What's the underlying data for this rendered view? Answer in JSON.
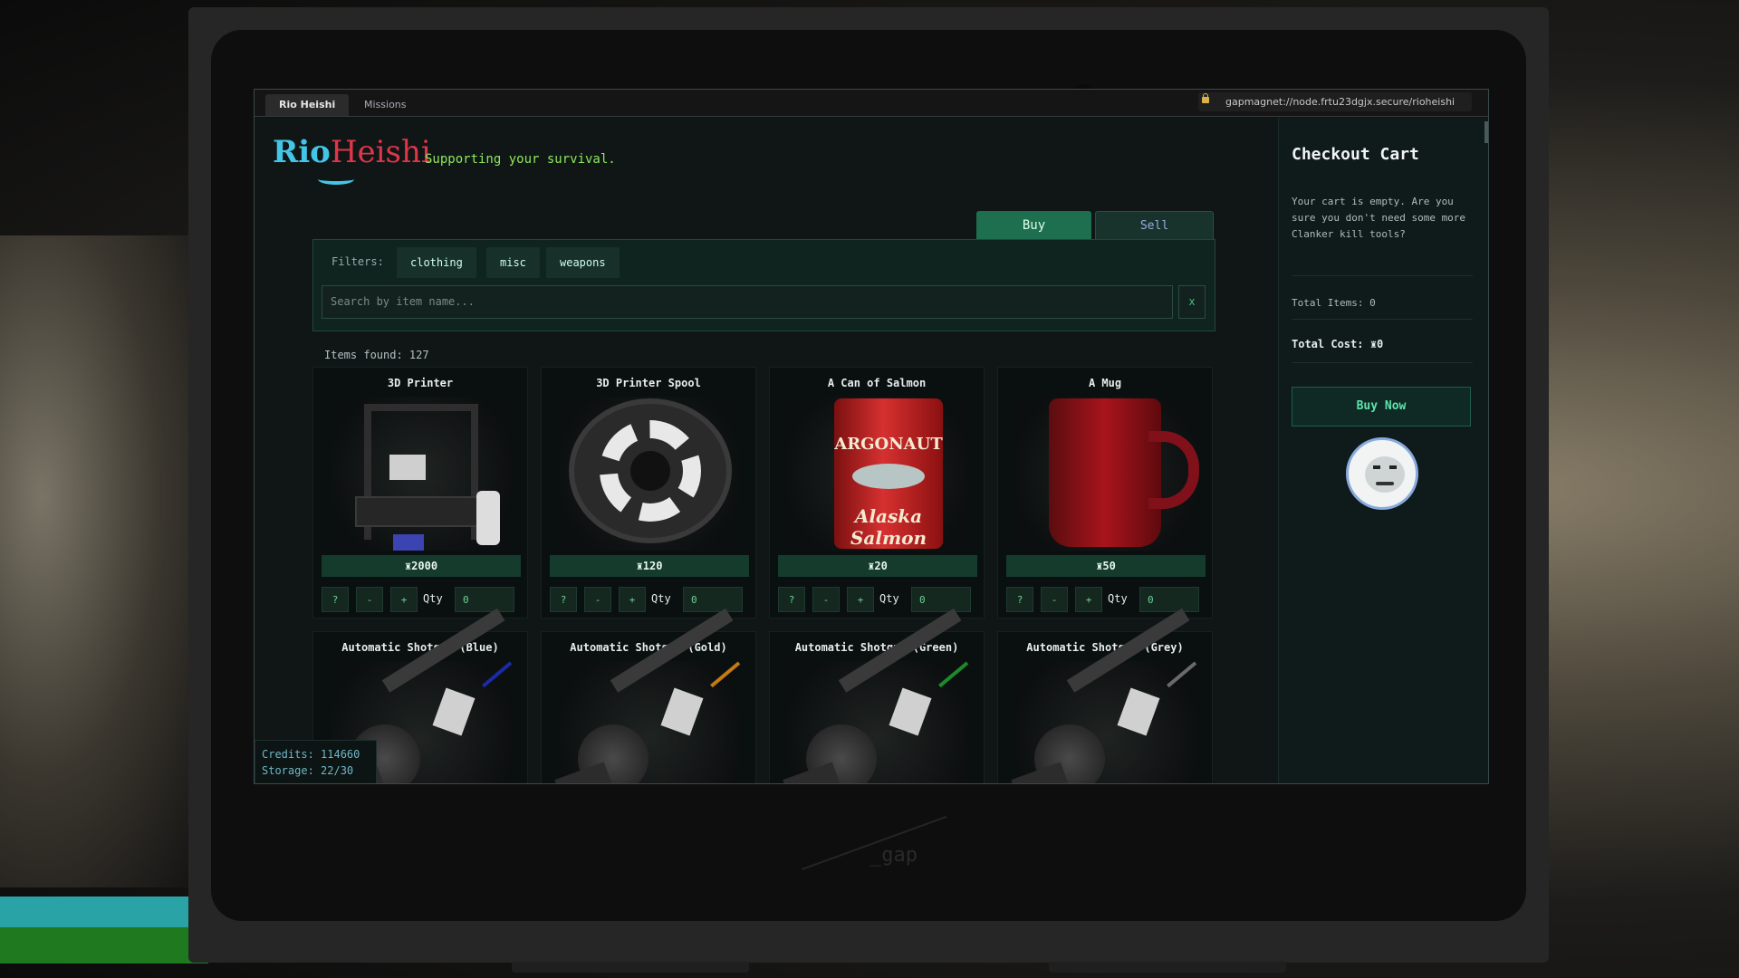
{
  "browser": {
    "tabs": [
      {
        "label": "Rio Heishi",
        "active": true
      },
      {
        "label": "Missions",
        "active": false
      }
    ],
    "url": "gapmagnet://node.frtu23dgjx.secure/rioheishi"
  },
  "header": {
    "logo_rio": "Rio",
    "logo_heishi": "Heishi",
    "tagline": "Supporting your survival."
  },
  "mode_tabs": {
    "buy": "Buy",
    "sell": "Sell"
  },
  "filters": {
    "label": "Filters:",
    "chips": [
      "clothing",
      "misc",
      "weapons"
    ],
    "search_placeholder": "Search by item name...",
    "clear_label": "x"
  },
  "results": {
    "items_found": "Items found: 127"
  },
  "items": [
    {
      "name": "3D Printer",
      "price": "2000",
      "qty": "0"
    },
    {
      "name": "3D Printer Spool",
      "price": "120",
      "qty": "0"
    },
    {
      "name": "A Can of Salmon",
      "price": "20",
      "qty": "0"
    },
    {
      "name": "A Mug",
      "price": "50",
      "qty": "0"
    },
    {
      "name": "Automatic Shotgun (Blue)",
      "accent": "#1a2aa8"
    },
    {
      "name": "Automatic Shotgun (Gold)",
      "accent": "#c27a12"
    },
    {
      "name": "Automatic Shotgun (Green)",
      "accent": "#1c8a2a"
    },
    {
      "name": "Automatic Shotgun (Grey)",
      "accent": "#6a6a6a"
    }
  ],
  "item_controls": {
    "info": "?",
    "minus": "-",
    "plus": "+",
    "qty_label": "Qty"
  },
  "salmon_can": {
    "brand": "ARGONAUT",
    "label": "Alaska Salmon"
  },
  "status": {
    "credits": "Credits: 114660",
    "storage": "Storage: 22/30"
  },
  "cart": {
    "title": "Checkout Cart",
    "empty_message": "Your cart is empty. Are you sure you don't need some more Clanker kill tools?",
    "total_items": "Total Items: 0",
    "total_cost_label": "Total Cost:",
    "total_cost_value": "0",
    "buy_now": "Buy Now"
  },
  "monitor_brand": "_gap",
  "currency_icon": "currency-icon",
  "colors": {
    "accent_green": "#1e6f50",
    "price_bg": "#153b2d",
    "logo_cyan": "#43c6e6",
    "logo_red": "#e0354a",
    "tagline_green": "#8ee85a"
  }
}
